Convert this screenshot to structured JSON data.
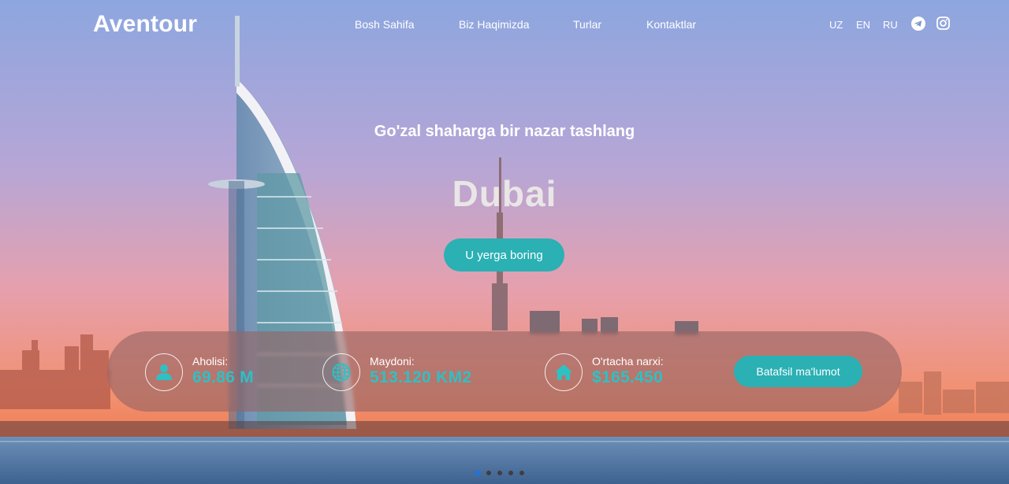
{
  "brand": {
    "logo": "Aventour"
  },
  "nav": {
    "items": [
      "Bosh Sahifa",
      "Biz Haqimizda",
      "Turlar",
      "Kontaktlar"
    ]
  },
  "languages": [
    "UZ",
    "EN",
    "RU"
  ],
  "social": [
    {
      "icon": "telegram-icon"
    },
    {
      "icon": "instagram-icon"
    }
  ],
  "hero": {
    "subtitle": "Go'zal shaharga bir nazar tashlang",
    "city": "Dubai",
    "cta_label": "U yerga boring"
  },
  "info": {
    "stats": [
      {
        "icon": "person-icon",
        "label": "Aholisi:",
        "value": "69.86 M"
      },
      {
        "icon": "globe-icon",
        "label": "Maydoni:",
        "value": "513.120 KM2"
      },
      {
        "icon": "home-icon",
        "label": "O'rtacha narxi:",
        "value": "$165.450"
      }
    ],
    "more_label": "Batafsil ma'lumot"
  },
  "slider": {
    "count": 5,
    "active_index": 1
  },
  "colors": {
    "accent": "#2bb0b4",
    "stat_value": "#2fc0c4",
    "sky_top": "#8fa7e0",
    "sky_bottom": "#f28a5a"
  }
}
